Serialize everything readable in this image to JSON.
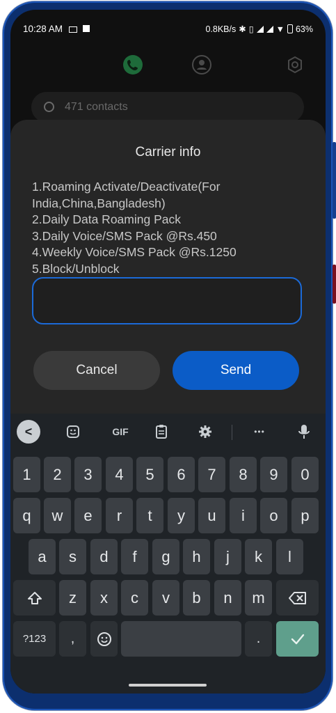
{
  "status_bar": {
    "time": "10:28 AM",
    "net_speed": "0.8KB/s",
    "battery": "63%"
  },
  "contacts": {
    "search_placeholder": "471 contacts"
  },
  "dialog": {
    "title": "Carrier info",
    "message_lines": [
      "1.Roaming Activate/Deactivate(For",
      "India,China,Bangladesh)",
      "2.Daily Data Roaming Pack",
      "3.Daily Voice/SMS Pack @Rs.450",
      "4.Weekly Voice/SMS Pack @Rs.1250",
      "5.Block/Unblock"
    ],
    "input_value": "",
    "cancel_label": "Cancel",
    "send_label": "Send",
    "input_border_color": "#1b6ad8",
    "send_color": "#0b5cc7"
  },
  "keyboard": {
    "toolbar": {
      "gif_label": "GIF",
      "more_label": "•••"
    },
    "row_numbers": [
      "1",
      "2",
      "3",
      "4",
      "5",
      "6",
      "7",
      "8",
      "9",
      "0"
    ],
    "row1": [
      "q",
      "w",
      "e",
      "r",
      "t",
      "y",
      "u",
      "i",
      "o",
      "p"
    ],
    "row2": [
      "a",
      "s",
      "d",
      "f",
      "g",
      "h",
      "j",
      "k",
      "l"
    ],
    "row3": [
      "z",
      "x",
      "c",
      "v",
      "b",
      "n",
      "m"
    ],
    "bottom": {
      "symbols_label": "?123",
      "comma": ",",
      "period": "."
    },
    "enter_color": "#5f9f8c"
  }
}
